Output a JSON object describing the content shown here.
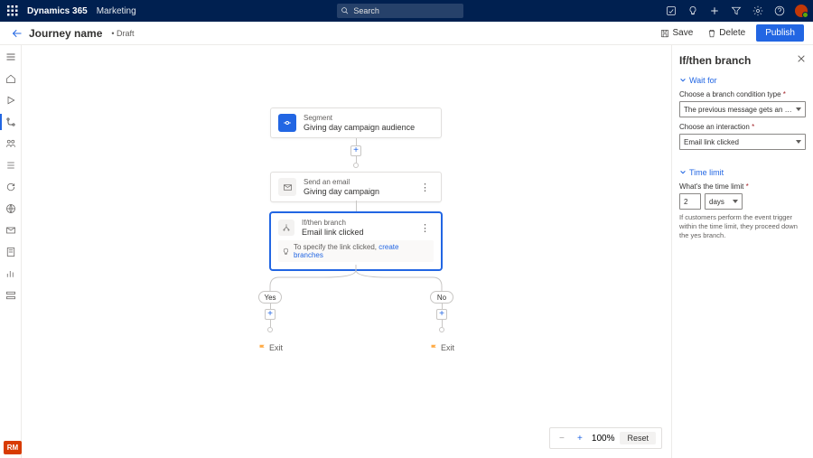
{
  "brand": {
    "product": "Dynamics 365",
    "module": "Marketing"
  },
  "search": {
    "placeholder": "Search"
  },
  "header": {
    "title": "Journey name",
    "status": "• Draft",
    "save": "Save",
    "delete": "Delete",
    "publish": "Publish"
  },
  "canvas": {
    "node1": {
      "label": "Segment",
      "title": "Giving day campaign audience"
    },
    "node2": {
      "label": "Send an email",
      "title": "Giving day campaign"
    },
    "node3": {
      "label": "If/then branch",
      "title": "Email link clicked",
      "hint_prefix": "To specify the link clicked, ",
      "hint_link": "create branches"
    },
    "yes": "Yes",
    "no": "No",
    "exit": "Exit"
  },
  "zoom": {
    "value": "100%",
    "reset": "Reset"
  },
  "panel": {
    "title": "If/then branch",
    "sec1": "Wait for",
    "cond_label": "Choose a branch condition type",
    "cond_value": "The previous message gets an interaction",
    "interaction_label": "Choose an interaction",
    "interaction_value": "Email link clicked",
    "sec2": "Time limit",
    "time_label": "What's the time limit",
    "time_value": "2",
    "time_unit": "days",
    "help": "If customers perform the event trigger within the time limit, they proceed down the yes branch."
  },
  "corner": "RM"
}
